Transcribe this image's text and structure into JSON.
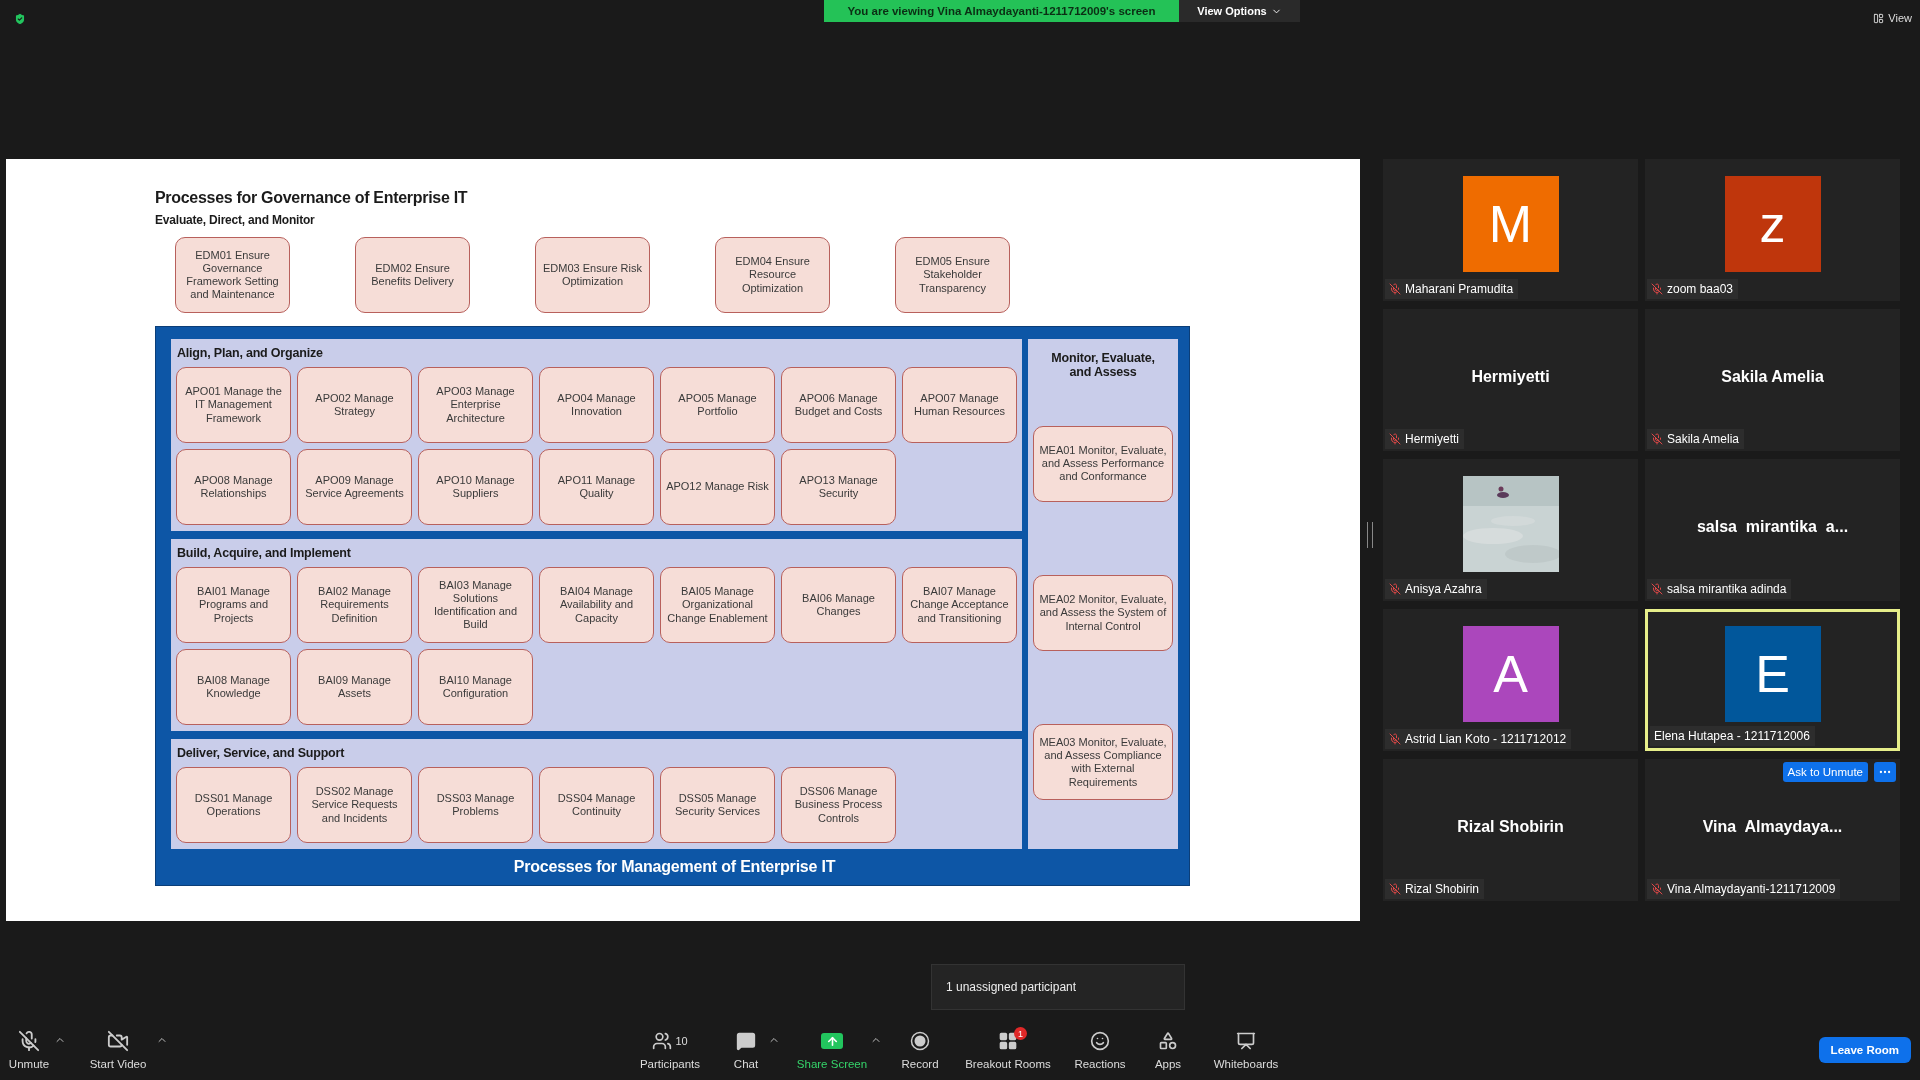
{
  "top_bar": {
    "banner": "You are viewing Vina Almaydayanti-1211712009's screen",
    "view_options": "View Options",
    "view": "View"
  },
  "slide": {
    "title": "Processes for Governance of Enterprise IT",
    "governance": {
      "heading": "Evaluate, Direct, and Monitor",
      "processes": [
        "EDM01 Ensure Governance Framework Setting and Maintenance",
        "EDM02 Ensure Benefits Delivery",
        "EDM03 Ensure Risk Optimization",
        "EDM04 Ensure Resource Optimization",
        "EDM05 Ensure Stakeholder Transparency"
      ]
    },
    "domains": [
      {
        "heading": "Align, Plan, and Organize",
        "processes": [
          "APO01 Manage the IT Management Framework",
          "APO02 Manage Strategy",
          "APO03 Manage Enterprise Architecture",
          "APO04 Manage Innovation",
          "APO05 Manage Portfolio",
          "APO06 Manage Budget and Costs",
          "APO07 Manage Human Resources",
          "APO08 Manage Relationships",
          "APO09 Manage Service Agreements",
          "APO10 Manage Suppliers",
          "APO11 Manage Quality",
          "APO12 Manage Risk",
          "APO13 Manage Security"
        ]
      },
      {
        "heading": "Build, Acquire, and Implement",
        "processes": [
          "BAI01 Manage Programs and Projects",
          "BAI02 Manage Requirements Definition",
          "BAI03 Manage Solutions Identification and Build",
          "BAI04 Manage Availability and Capacity",
          "BAI05 Manage Organizational Change Enablement",
          "BAI06 Manage Changes",
          "BAI07 Manage Change Acceptance and Transitioning",
          "BAI08 Manage Knowledge",
          "BAI09 Manage Assets",
          "BAI10 Manage Configuration"
        ]
      },
      {
        "heading": "Deliver, Service, and Support",
        "processes": [
          "DSS01 Manage Operations",
          "DSS02 Manage Service Requests and Incidents",
          "DSS03 Manage Problems",
          "DSS04 Manage Continuity",
          "DSS05 Manage Security Services",
          "DSS06 Manage Business Process Controls"
        ]
      }
    ],
    "monitor": {
      "heading": "Monitor, Evaluate, and Assess",
      "processes": [
        "MEA01 Monitor, Evaluate, and Assess Performance and Conformance",
        "MEA02 Monitor, Evaluate, and Assess the System of Internal Control",
        "MEA03 Monitor, Evaluate, and Assess Compliance with External Requirements"
      ]
    },
    "footer": "Processes for Management of Enterprise IT"
  },
  "participants": [
    {
      "kind": "avatar",
      "initial": "M",
      "color": "#ef6c00",
      "name": "Maharani Pramudita",
      "muted": true,
      "active_speaker": false
    },
    {
      "kind": "avatar",
      "initial": "z",
      "color": "#bf360c",
      "name": "zoom baa03",
      "muted": true,
      "active_speaker": false
    },
    {
      "kind": "name",
      "display_name": "Hermiyetti",
      "name": "Hermiyetti",
      "muted": true,
      "active_speaker": false
    },
    {
      "kind": "name",
      "display_name": "Sakila Amelia",
      "name": "Sakila Amelia",
      "muted": true,
      "active_speaker": false
    },
    {
      "kind": "picture",
      "name": "Anisya Azahra",
      "muted": true,
      "active_speaker": false
    },
    {
      "kind": "name",
      "display_name": "salsa  mirantika  a...",
      "name": "salsa mirantika adinda",
      "muted": true,
      "active_speaker": false
    },
    {
      "kind": "avatar",
      "initial": "A",
      "color": "#ab47bc",
      "name": "Astrid Lian Koto - 1211712012",
      "muted": true,
      "active_speaker": false
    },
    {
      "kind": "avatar",
      "initial": "E",
      "color": "#01579b",
      "name": "Elena Hutapea - 1211712006",
      "muted": false,
      "active_speaker": true
    },
    {
      "kind": "name",
      "display_name": "Rizal Shobirin",
      "name": "Rizal Shobirin",
      "muted": true,
      "active_speaker": false
    },
    {
      "kind": "name",
      "display_name": "Vina  Almaydaya...",
      "name": "Vina Almaydayanti-1211712009",
      "muted": true,
      "active_speaker": false,
      "ask_to_unmute": "Ask to Unmute"
    }
  ],
  "tooltip": "1 unassigned participant",
  "toolbar": [
    {
      "kind": "mic",
      "label": "Unmute",
      "menu": true
    },
    {
      "kind": "video",
      "label": "Start Video",
      "menu": true
    },
    {
      "kind": "participants",
      "label": "Participants",
      "count": "10",
      "menu": false
    },
    {
      "kind": "chat",
      "label": "Chat",
      "menu": true
    },
    {
      "kind": "share",
      "label": "Share Screen",
      "menu": true
    },
    {
      "kind": "record",
      "label": "Record",
      "menu": false
    },
    {
      "kind": "breakout",
      "label": "Breakout Rooms",
      "badge": "1",
      "menu": false
    },
    {
      "kind": "reactions",
      "label": "Reactions",
      "menu": false
    },
    {
      "kind": "apps",
      "label": "Apps",
      "menu": false
    },
    {
      "kind": "whiteboard",
      "label": "Whiteboards",
      "menu": false
    }
  ],
  "leave": "Leave Room"
}
